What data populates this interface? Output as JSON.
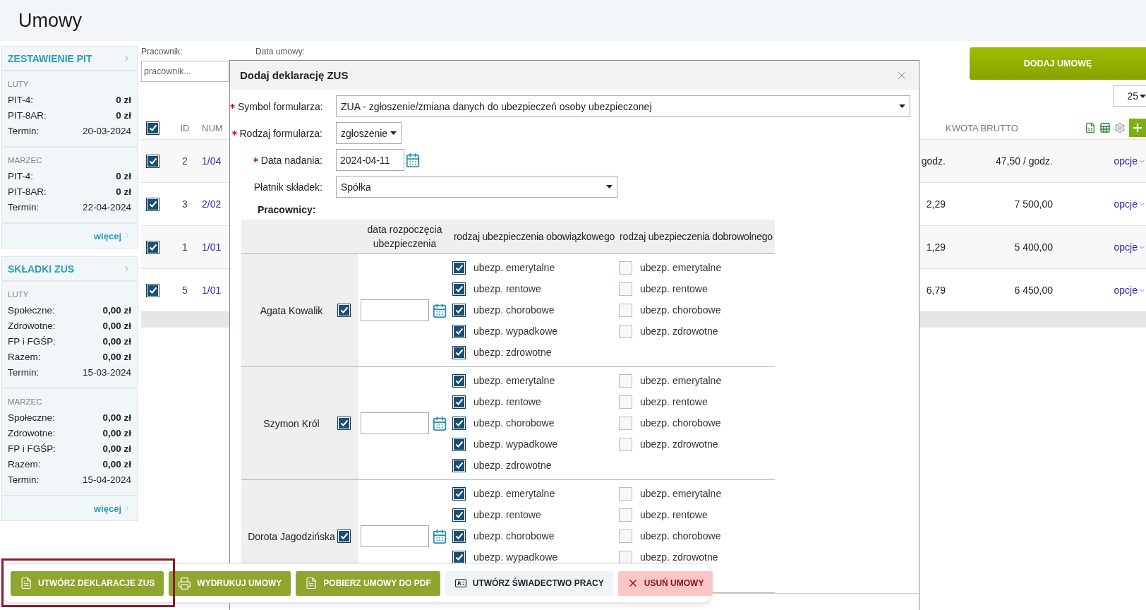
{
  "page_title": "Umowy",
  "sidebar": {
    "cards": [
      {
        "title": "ZESTAWIENIE PIT",
        "more": "więcej",
        "sections": [
          {
            "month": "LUTY",
            "rows": [
              {
                "label": "PIT-4:",
                "value": "0 zł",
                "kind": "amount"
              },
              {
                "label": "PIT-8AR:",
                "value": "0 zł",
                "kind": "amount"
              },
              {
                "label": "Termin:",
                "value": "20-03-2024",
                "kind": "date"
              }
            ]
          },
          {
            "month": "MARZEC",
            "rows": [
              {
                "label": "PIT-4:",
                "value": "0 zł",
                "kind": "amount"
              },
              {
                "label": "PIT-8AR:",
                "value": "0 zł",
                "kind": "amount"
              },
              {
                "label": "Termin:",
                "value": "22-04-2024",
                "kind": "date"
              }
            ]
          }
        ]
      },
      {
        "title": "SKŁADKI ZUS",
        "more": "więcej",
        "sections": [
          {
            "month": "LUTY",
            "rows": [
              {
                "label": "Społeczne:",
                "value": "0,00 zł",
                "kind": "amount"
              },
              {
                "label": "Zdrowotne:",
                "value": "0,00 zł",
                "kind": "amount"
              },
              {
                "label": "FP i FGŚP:",
                "value": "0,00 zł",
                "kind": "amount"
              },
              {
                "label": "Razem:",
                "value": "0,00 zł",
                "kind": "amount"
              },
              {
                "label": "Termin:",
                "value": "15-03-2024",
                "kind": "date"
              }
            ]
          },
          {
            "month": "MARZEC",
            "rows": [
              {
                "label": "Społeczne:",
                "value": "0,00 zł",
                "kind": "amount"
              },
              {
                "label": "Zdrowotne:",
                "value": "0,00 zł",
                "kind": "amount"
              },
              {
                "label": "FP i FGŚP:",
                "value": "0,00 zł",
                "kind": "amount"
              },
              {
                "label": "Razem:",
                "value": "0,00 zł",
                "kind": "amount"
              },
              {
                "label": "Termin:",
                "value": "15-04-2024",
                "kind": "date"
              }
            ]
          }
        ]
      }
    ]
  },
  "filters": [
    {
      "label": "Pracownik:",
      "placeholder": "pracownik..."
    },
    {
      "label": "Data umowy:"
    }
  ],
  "add_button": "DODAJ UMOWĘ",
  "page_size": "25",
  "table": {
    "all_checked": true,
    "columns": [
      "ID",
      "NUM",
      "KWOTA BRUTTO"
    ],
    "rows": [
      {
        "checked": true,
        "id": "2",
        "number": "1/04",
        "column_cut": "godz.",
        "gross": "47,50 / godz.",
        "options": "opcje"
      },
      {
        "checked": true,
        "id": "3",
        "number": "2/02",
        "column_cut": "2,29",
        "gross": "7 500,00",
        "options": "opcje"
      },
      {
        "checked": true,
        "id": "1",
        "number": "1/01",
        "column_cut": "1,29",
        "gross": "5 400,00",
        "options": "opcje"
      },
      {
        "checked": true,
        "id": "5",
        "number": "1/01",
        "column_cut": "6,79",
        "gross": "6 450,00",
        "options": "opcje"
      }
    ]
  },
  "dialog": {
    "title": "Dodaj deklarację ZUS",
    "fields": [
      {
        "label": "Symbol formularza:",
        "required": true,
        "kind": "select",
        "value": "ZUA - zgłoszenie/zmiana danych do ubezpieczeń osoby ubezpieczonej"
      },
      {
        "label": "Rodzaj formularza:",
        "required": true,
        "kind": "select",
        "value": "zgłoszenie"
      },
      {
        "label": "Data nadania:",
        "required": true,
        "kind": "date",
        "value": "2024-04-11"
      },
      {
        "label": "Płatnik składek:",
        "required": false,
        "kind": "select",
        "value": "Spółka"
      }
    ],
    "employees_title": "Pracownicy:",
    "columns": [
      "data rozpoczęcia ubezpieczenia",
      "rodzaj ubezpieczenia obowiązkowego",
      "rodzaj ubezpieczenia dobrowolnego"
    ],
    "employees": [
      {
        "name": "Agata Kowalik",
        "checked": true,
        "mandatory": [
          {
            "label": "ubezp. emerytalne",
            "checked": true
          },
          {
            "label": "ubezp. rentowe",
            "checked": true
          },
          {
            "label": "ubezp. chorobowe",
            "checked": true
          },
          {
            "label": "ubezp. wypadkowe",
            "checked": true
          },
          {
            "label": "ubezp. zdrowotne",
            "checked": true
          }
        ],
        "voluntary": [
          {
            "label": "ubezp. emerytalne",
            "checked": false
          },
          {
            "label": "ubezp. rentowe",
            "checked": false
          },
          {
            "label": "ubezp. chorobowe",
            "checked": false
          },
          {
            "label": "ubezp. zdrowotne",
            "checked": false
          }
        ]
      },
      {
        "name": "Szymon Król",
        "checked": true,
        "mandatory": [
          {
            "label": "ubezp. emerytalne",
            "checked": true
          },
          {
            "label": "ubezp. rentowe",
            "checked": true
          },
          {
            "label": "ubezp. chorobowe",
            "checked": true
          },
          {
            "label": "ubezp. wypadkowe",
            "checked": true
          },
          {
            "label": "ubezp. zdrowotne",
            "checked": true
          }
        ],
        "voluntary": [
          {
            "label": "ubezp. emerytalne",
            "checked": false
          },
          {
            "label": "ubezp. rentowe",
            "checked": false
          },
          {
            "label": "ubezp. chorobowe",
            "checked": false
          },
          {
            "label": "ubezp. zdrowotne",
            "checked": false
          }
        ]
      },
      {
        "name": "Dorota Jagodzińska",
        "checked": true,
        "mandatory": [
          {
            "label": "ubezp. emerytalne",
            "checked": true
          },
          {
            "label": "ubezp. rentowe",
            "checked": true
          },
          {
            "label": "ubezp. chorobowe",
            "checked": true
          },
          {
            "label": "ubezp. wypadkowe",
            "checked": true
          }
        ],
        "voluntary": [
          {
            "label": "ubezp. emerytalne",
            "checked": false
          },
          {
            "label": "ubezp. rentowe",
            "checked": false
          },
          {
            "label": "ubezp. chorobowe",
            "checked": false
          },
          {
            "label": "ubezp. zdrowotne",
            "checked": false
          }
        ]
      }
    ]
  },
  "toolbar": {
    "buttons": [
      {
        "label": "UTWÓRZ DEKLARACJE ZUS",
        "kind": "zus",
        "highlighted": true
      },
      {
        "label": "WYDRUKUJ UMOWY",
        "kind": "print",
        "highlighted": false
      },
      {
        "label": "POBIERZ UMOWY DO PDF",
        "kind": "pdf",
        "highlighted": false
      },
      {
        "label": "UTWÓRZ ŚWIADECTWO PRACY",
        "kind": "certificate",
        "highlighted": false
      },
      {
        "label": "USUŃ UMOWY",
        "kind": "delete",
        "highlighted": false
      }
    ]
  }
}
